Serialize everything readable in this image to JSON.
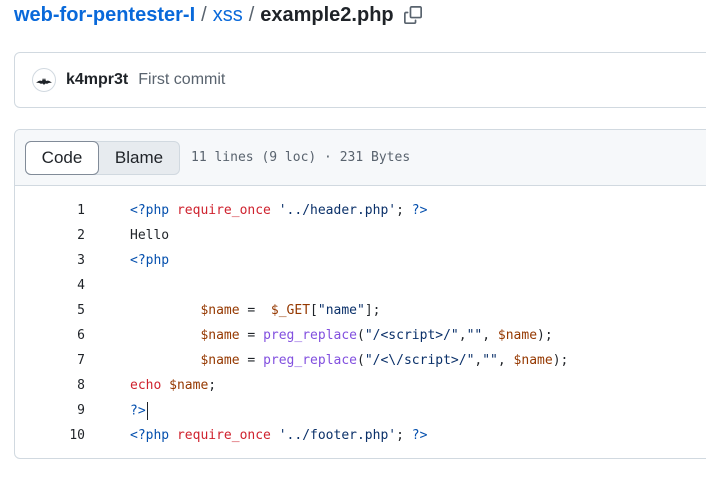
{
  "breadcrumb": {
    "repo": "web-for-pentester-I",
    "sep1": "/",
    "folder": "xss",
    "sep2": "/",
    "file": "example2.php",
    "copy_icon": "copy-icon"
  },
  "commit": {
    "avatar_icon": "bat-avatar",
    "author": "k4mpr3t",
    "message": "First commit"
  },
  "file_header": {
    "tabs": [
      {
        "label": "Code",
        "active": true
      },
      {
        "label": "Blame",
        "active": false
      }
    ],
    "info": "11 lines (9 loc) · 231 Bytes"
  },
  "code": {
    "lines": [
      {
        "num": "1",
        "tokens": [
          {
            "t": "<?php",
            "c": "tag"
          },
          {
            "t": " ",
            "c": "p"
          },
          {
            "t": "require_once",
            "c": "k"
          },
          {
            "t": " ",
            "c": "p"
          },
          {
            "t": "'../header.php'",
            "c": "s"
          },
          {
            "t": "; ",
            "c": "p"
          },
          {
            "t": "?>",
            "c": "tag"
          }
        ]
      },
      {
        "num": "2",
        "tokens": [
          {
            "t": "Hello",
            "c": "p"
          }
        ]
      },
      {
        "num": "3",
        "tokens": [
          {
            "t": "<?php",
            "c": "tag"
          }
        ]
      },
      {
        "num": "4",
        "tokens": []
      },
      {
        "num": "5",
        "tokens": [
          {
            "t": "         ",
            "c": "p"
          },
          {
            "t": "$name",
            "c": "v"
          },
          {
            "t": " =  ",
            "c": "p"
          },
          {
            "t": "$_GET",
            "c": "v"
          },
          {
            "t": "[",
            "c": "p"
          },
          {
            "t": "\"name\"",
            "c": "s"
          },
          {
            "t": "];",
            "c": "p"
          }
        ]
      },
      {
        "num": "6",
        "tokens": [
          {
            "t": "         ",
            "c": "p"
          },
          {
            "t": "$name",
            "c": "v"
          },
          {
            "t": " = ",
            "c": "p"
          },
          {
            "t": "preg_replace",
            "c": "f"
          },
          {
            "t": "(",
            "c": "p"
          },
          {
            "t": "\"/<script>/\"",
            "c": "s"
          },
          {
            "t": ",",
            "c": "p"
          },
          {
            "t": "\"\"",
            "c": "s"
          },
          {
            "t": ", ",
            "c": "p"
          },
          {
            "t": "$name",
            "c": "v"
          },
          {
            "t": ");",
            "c": "p"
          }
        ]
      },
      {
        "num": "7",
        "tokens": [
          {
            "t": "         ",
            "c": "p"
          },
          {
            "t": "$name",
            "c": "v"
          },
          {
            "t": " = ",
            "c": "p"
          },
          {
            "t": "preg_replace",
            "c": "f"
          },
          {
            "t": "(",
            "c": "p"
          },
          {
            "t": "\"/<\\/script>/\"",
            "c": "s"
          },
          {
            "t": ",",
            "c": "p"
          },
          {
            "t": "\"\"",
            "c": "s"
          },
          {
            "t": ", ",
            "c": "p"
          },
          {
            "t": "$name",
            "c": "v"
          },
          {
            "t": ");",
            "c": "p"
          }
        ]
      },
      {
        "num": "8",
        "tokens": [
          {
            "t": "echo",
            "c": "k"
          },
          {
            "t": " ",
            "c": "p"
          },
          {
            "t": "$name",
            "c": "v"
          },
          {
            "t": ";",
            "c": "p"
          }
        ]
      },
      {
        "num": "9",
        "tokens": [
          {
            "t": "?>",
            "c": "tag"
          }
        ],
        "caret": true
      },
      {
        "num": "10",
        "tokens": [
          {
            "t": "<?php",
            "c": "tag"
          },
          {
            "t": " ",
            "c": "p"
          },
          {
            "t": "require_once",
            "c": "k"
          },
          {
            "t": " ",
            "c": "p"
          },
          {
            "t": "'../footer.php'",
            "c": "s"
          },
          {
            "t": "; ",
            "c": "p"
          },
          {
            "t": "?>",
            "c": "tag"
          }
        ]
      }
    ]
  },
  "colors": {
    "link": "#0969da",
    "keyword": "#cf222e",
    "function": "#8250df",
    "string": "#0a3069",
    "variable": "#953800",
    "php_tag": "#0550ae"
  }
}
